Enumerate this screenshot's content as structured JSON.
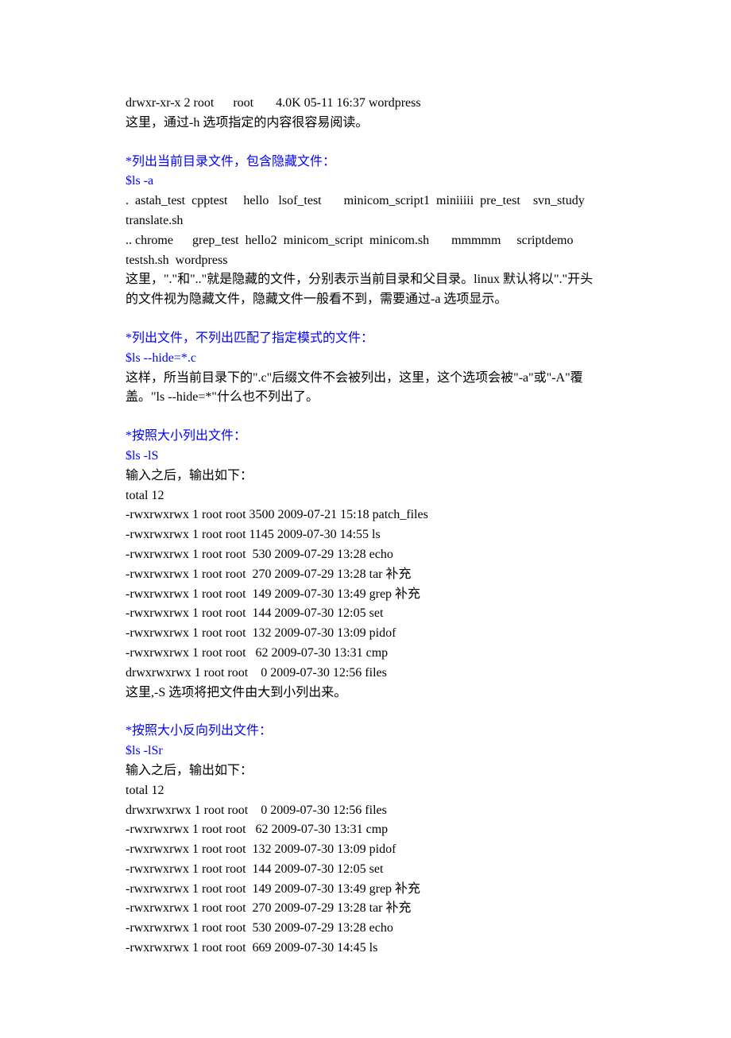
{
  "intro": {
    "output_line": "drwxr-xr-x 2 root      root       4.0K 05-11 16:37 wordpress",
    "explain": "这里，通过-h 选项指定的内容很容易阅读。"
  },
  "section_ls_a": {
    "heading": "*列出当前目录文件，包含隐藏文件：",
    "cmd": "$ls -a",
    "out_line1": ".  astah_test  cpptest     hello   lsof_test       minicom_script1  miniiiii  pre_test    svn_study   translate.sh",
    "out_line2": ".. chrome      grep_test  hello2  minicom_script  minicom.sh       mmmmm     scriptdemo  testsh.sh  wordpress",
    "explain": "这里，\".\"和\"..\"就是隐藏的文件，分别表示当前目录和父目录。linux 默认将以\".\"开头的文件视为隐藏文件，隐藏文件一般看不到，需要通过-a 选项显示。"
  },
  "section_hide": {
    "heading": "*列出文件，不列出匹配了指定模式的文件：",
    "cmd": "$ls --hide=*.c",
    "explain": "这样，所当前目录下的\".c\"后缀文件不会被列出，这里，这个选项会被\"-a\"或\"-A\"覆盖。\"ls --hide=*\"什么也不列出了。"
  },
  "section_lS": {
    "heading": "*按照大小列出文件：",
    "cmd": "$ls -lS",
    "prompt": "输入之后，输出如下：",
    "total": "total 12",
    "rows": [
      "-rwxrwxrwx 1 root root 3500 2009-07-21 15:18 patch_files",
      "-rwxrwxrwx 1 root root 1145 2009-07-30 14:55 ls",
      "-rwxrwxrwx 1 root root  530 2009-07-29 13:28 echo",
      "-rwxrwxrwx 1 root root  270 2009-07-29 13:28 tar 补充",
      "-rwxrwxrwx 1 root root  149 2009-07-30 13:49 grep 补充",
      "-rwxrwxrwx 1 root root  144 2009-07-30 12:05 set",
      "-rwxrwxrwx 1 root root  132 2009-07-30 13:09 pidof",
      "-rwxrwxrwx 1 root root   62 2009-07-30 13:31 cmp",
      "drwxrwxrwx 1 root root    0 2009-07-30 12:56 files"
    ],
    "explain": "这里,-S 选项将把文件由大到小列出来。"
  },
  "section_lSr": {
    "heading": "*按照大小反向列出文件：",
    "cmd": "$ls -lSr",
    "prompt": "输入之后，输出如下：",
    "total": "total 12",
    "rows": [
      "drwxrwxrwx 1 root root    0 2009-07-30 12:56 files",
      "-rwxrwxrwx 1 root root   62 2009-07-30 13:31 cmp",
      "-rwxrwxrwx 1 root root  132 2009-07-30 13:09 pidof",
      "-rwxrwxrwx 1 root root  144 2009-07-30 12:05 set",
      "-rwxrwxrwx 1 root root  149 2009-07-30 13:49 grep 补充",
      "-rwxrwxrwx 1 root root  270 2009-07-29 13:28 tar 补充",
      "-rwxrwxrwx 1 root root  530 2009-07-29 13:28 echo",
      "-rwxrwxrwx 1 root root  669 2009-07-30 14:45 ls"
    ]
  }
}
